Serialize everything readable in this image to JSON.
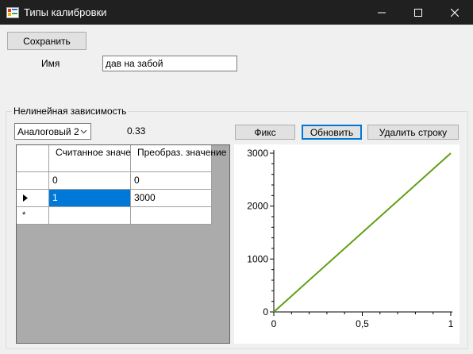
{
  "window": {
    "title": "Типы калибровки",
    "colors": {
      "titlebar": "#202020",
      "accent": "#0078d7"
    }
  },
  "toolbar": {
    "save_label": "Сохранить"
  },
  "form": {
    "name_label": "Имя",
    "name_value": "дав на забой"
  },
  "group": {
    "title": "Нелинейная зависимость",
    "channel_selected": "Аналоговый 2",
    "coefficient": "0.33",
    "fix_label": "Фикс",
    "refresh_label": "Обновить",
    "delete_row_label": "Удалить строку"
  },
  "table": {
    "columns": [
      "Считанное значение",
      "Преобраз. значение"
    ],
    "rows": [
      {
        "read": "0",
        "converted": "0"
      },
      {
        "read": "1",
        "converted": "3000"
      }
    ],
    "new_row_marker": "*"
  },
  "chart_data": {
    "type": "line",
    "series": [
      {
        "color": "#5fa014",
        "x": [
          0,
          1
        ],
        "y": [
          0,
          3000
        ]
      }
    ],
    "xlim": [
      0,
      1
    ],
    "ylim": [
      0,
      3000
    ],
    "x_ticks": [
      "0",
      "0,5",
      "1"
    ],
    "y_ticks": [
      "0",
      "1000",
      "2000",
      "3000"
    ]
  }
}
